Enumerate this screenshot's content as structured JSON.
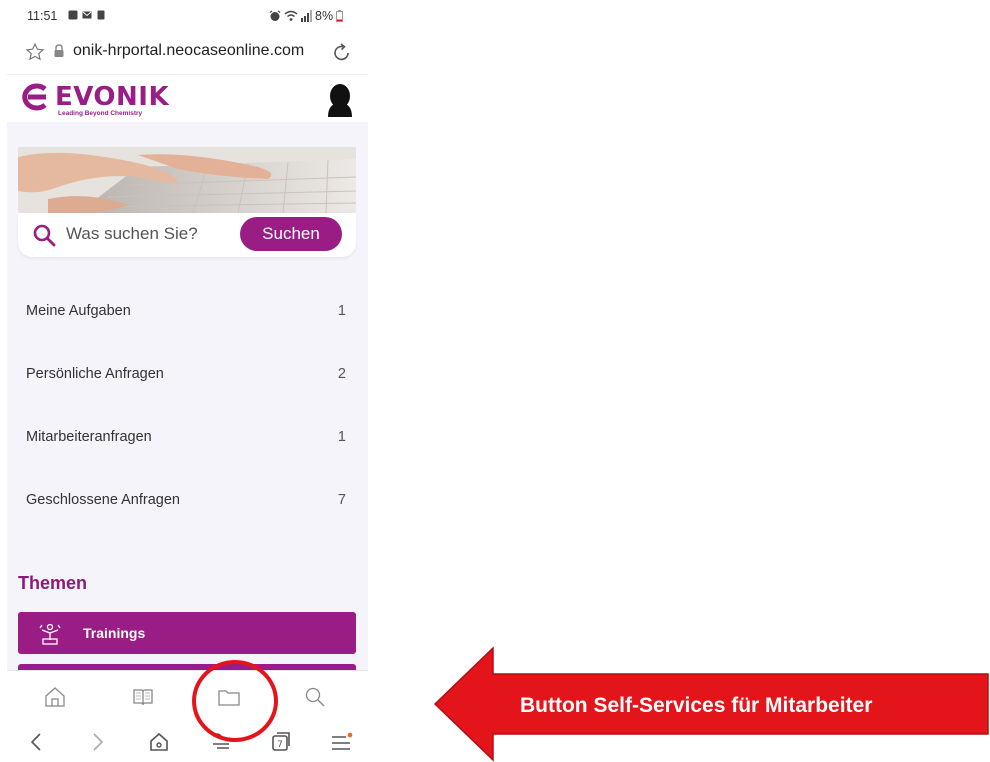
{
  "status_bar": {
    "time": "11:51",
    "battery": "8%"
  },
  "browser": {
    "url": "onik-hrportal.neocaseonline.com"
  },
  "header": {
    "logo_text": "EVONIK",
    "logo_tagline": "Leading Beyond Chemistry"
  },
  "search": {
    "placeholder": "Was suchen Sie?",
    "button_label": "Suchen"
  },
  "requests": [
    {
      "label": "Meine Aufgaben",
      "count": "1"
    },
    {
      "label": "Persönliche Anfragen",
      "count": "2"
    },
    {
      "label": "Mitarbeiteranfragen",
      "count": "1"
    },
    {
      "label": "Geschlossene Anfragen",
      "count": "7"
    }
  ],
  "themes": {
    "heading": "Themen",
    "items": [
      {
        "label": "Trainings",
        "icon": "training-icon"
      }
    ]
  },
  "toolbar": {
    "icons": [
      "home-icon",
      "book-icon",
      "folder-icon",
      "search-icon"
    ]
  },
  "nav": {
    "icons": [
      "back-icon",
      "forward-icon",
      "home-icon",
      "bookmarks-icon",
      "tabs-icon",
      "menu-icon"
    ],
    "tabs_count": "7"
  },
  "annotation": {
    "text": "Button Self-Services für Mitarbeiter"
  },
  "colors": {
    "brand": "#991d85",
    "annotation_red": "#e4141b"
  }
}
